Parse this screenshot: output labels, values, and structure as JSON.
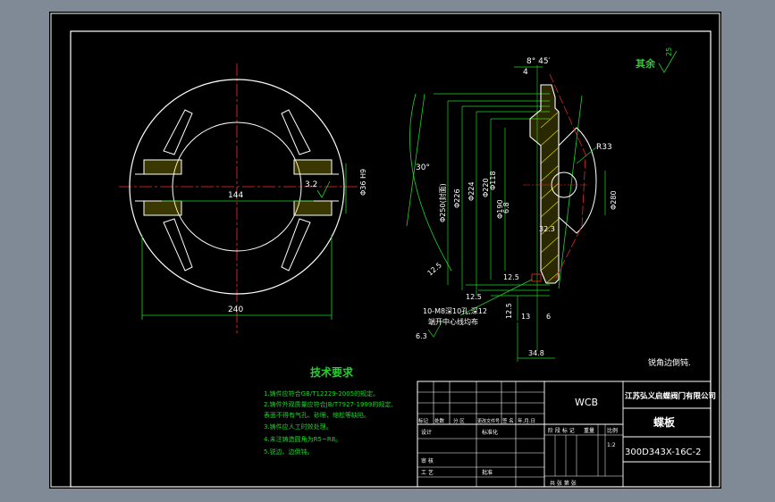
{
  "colors": {
    "background_outer": "#7f8a96",
    "drawing_bg": "#000000",
    "line_white": "#ffffff",
    "dim_green": "#1fd42a",
    "center_red": "#ff2a2a",
    "hatch_yellow": "#e8e000",
    "text_white": "#ffffff",
    "annotation_green": "#1fd42a"
  },
  "front_view": {
    "dim_144": "144",
    "dim_240": "240",
    "dim_3_2": "3.2",
    "dim_36_h9": "Φ36 H9",
    "dim_phi36": "Φ36 H9"
  },
  "section_view": {
    "angle_top": "8° 45′",
    "dim_4": "4",
    "angle_left": "30°",
    "roughness_note": "其余",
    "roughness_value": "25",
    "dim_r33": "R33",
    "dim_phi280": "Φ280",
    "dim_phi250": "Φ250(封面)",
    "dim_phi226": "Φ226",
    "dim_phi224": "Φ224",
    "dim_phi220": "Φ220",
    "dim_phi190": "Φ190",
    "dim_phi118": "Φ118",
    "dim_6_8": "6.8",
    "dim_32_3": "32.3",
    "dim_12_5_left": "12.5",
    "dim_12_5_b": "12.5",
    "dim_12_5_c": "12.5",
    "dim_12_5_d": "12.5",
    "dim_13": "13",
    "dim_6": "6",
    "dim_34_8": "34.8",
    "dim_6_3": "6.3",
    "hole_note_1": "10-M8深10孔,深12",
    "hole_note_2": "端开中心线均布",
    "edge_note": "锐角边倒钝."
  },
  "tech_requirements": {
    "title": "技术要求",
    "items": [
      "1.铸件应符合GB/T12229-2005的规定。",
      "2.铸件外观质量应符合JB/T7927-1999的规定,",
      "  表面不得有气孔、砂眼、缩松等缺陷。",
      "3.铸件应人工时效处理。",
      "4.未注铸造圆角为R5~R8。",
      "5.锐边、边倒钝。"
    ]
  },
  "title_block": {
    "material": "WCB",
    "company": "江苏弘义启蝶阀门有限公司",
    "part_name": "蝶板",
    "drawing_no": "300D343X-16C-2",
    "scale_value": "1:2",
    "header_labels": [
      "标记",
      "处数",
      "分 区",
      "更改文件号",
      "签 名",
      "年.月.日"
    ],
    "row_design": "设计",
    "row_std": "标准化",
    "row_review": "审 核",
    "row_process": "工 艺",
    "row_approve": "批准",
    "stage_mark": "阶 段 标 记",
    "weight": "重量",
    "scale": "比例",
    "sheet_info": "共   张   第   张"
  }
}
